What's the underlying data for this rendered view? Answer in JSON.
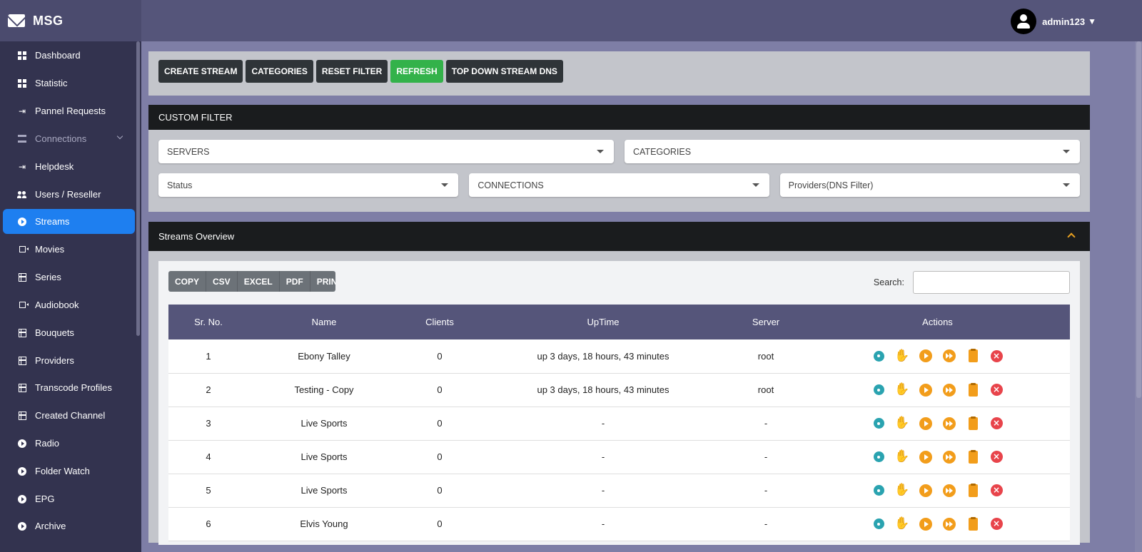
{
  "app": {
    "name": "MSG"
  },
  "user": {
    "name": "admin123"
  },
  "sidebar": {
    "items": [
      {
        "label": "Dashboard",
        "icon": "grid-icon"
      },
      {
        "label": "Statistic",
        "icon": "grid-icon"
      },
      {
        "label": "Pannel Requests",
        "icon": "enter-icon"
      },
      {
        "label": "Connections",
        "icon": "server-icon"
      },
      {
        "label": "Helpdesk",
        "icon": "enter-icon"
      },
      {
        "label": "Users / Reseller",
        "icon": "users-icon"
      },
      {
        "label": "Streams",
        "icon": "play-icon"
      },
      {
        "label": "Movies",
        "icon": "video-icon"
      },
      {
        "label": "Series",
        "icon": "film-icon"
      },
      {
        "label": "Audiobook",
        "icon": "video-icon"
      },
      {
        "label": "Bouquets",
        "icon": "film-icon"
      },
      {
        "label": "Providers",
        "icon": "film-icon"
      },
      {
        "label": "Transcode Profiles",
        "icon": "film-icon"
      },
      {
        "label": "Created Channel",
        "icon": "film-icon"
      },
      {
        "label": "Radio",
        "icon": "play-icon"
      },
      {
        "label": "Folder Watch",
        "icon": "play-icon"
      },
      {
        "label": "EPG",
        "icon": "play-icon"
      },
      {
        "label": "Archive",
        "icon": "play-icon"
      }
    ],
    "active": "Streams"
  },
  "toolbar": {
    "buttons": [
      "CREATE STREAM",
      "CATEGORIES",
      "RESET FILTER",
      "REFRESH",
      "TOP DOWN STREAM DNS"
    ]
  },
  "filter": {
    "title": "CUSTOM FILTER",
    "selects": [
      "SERVERS",
      "CATEGORIES",
      "Status",
      "CONNECTIONS",
      "Providers(DNS Filter)"
    ]
  },
  "overview": {
    "title": "Streams Overview",
    "exports": [
      "COPY",
      "CSV",
      "EXCEL",
      "PDF",
      "PRINT"
    ],
    "search_label": "Search:",
    "search_value": "",
    "columns": [
      "Sr. No.",
      "Name",
      "Clients",
      "UpTime",
      "Server",
      "Actions"
    ],
    "rows": [
      {
        "no": "1",
        "name": "Ebony Talley",
        "clients": "0",
        "uptime": "up 3 days, 18 hours, 43 minutes",
        "server": "root"
      },
      {
        "no": "2",
        "name": "Testing - Copy",
        "clients": "0",
        "uptime": "up 3 days, 18 hours, 43 minutes",
        "server": "root"
      },
      {
        "no": "3",
        "name": "Live Sports",
        "clients": "0",
        "uptime": "-",
        "server": "-"
      },
      {
        "no": "4",
        "name": "Live Sports",
        "clients": "0",
        "uptime": "-",
        "server": "-"
      },
      {
        "no": "5",
        "name": "Live Sports",
        "clients": "0",
        "uptime": "-",
        "server": "-"
      },
      {
        "no": "6",
        "name": "Elvis Young",
        "clients": "0",
        "uptime": "-",
        "server": "-"
      }
    ],
    "action_icons": [
      "gear-icon",
      "stop-hand-icon",
      "play-icon",
      "fast-forward-icon",
      "clipboard-icon",
      "close-circle-icon"
    ]
  },
  "colors": {
    "accent": "#1e7ff0",
    "refresh": "#33b24a",
    "header": "#55557a",
    "sidebar": "#33334f"
  }
}
